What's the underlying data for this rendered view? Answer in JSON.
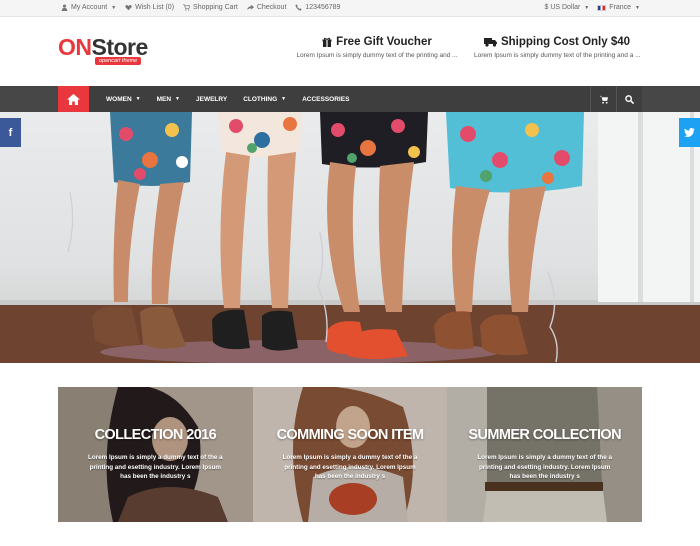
{
  "topbar": {
    "account": "My Account",
    "wishlist": "Wish List (0)",
    "cart": "Shopping Cart",
    "checkout": "Checkout",
    "phone": "123456789",
    "currency": "$ US Dollar",
    "language": "France"
  },
  "brand": {
    "on": "ON",
    "store": "Store",
    "tagline": "opencart theme"
  },
  "promos": [
    {
      "title": "Free Gift Voucher",
      "subtitle": "Lorem Ipsum is simply dummy text of the printing and ...",
      "icon": "gift-icon"
    },
    {
      "title": "Shipping Cost Only $40",
      "subtitle": "Lorem Ipsum is simply dummy text of the printing and a ...",
      "icon": "truck-icon"
    }
  ],
  "nav": {
    "items": [
      "WOMEN",
      "MEN",
      "JEWELRY",
      "CLOTHING",
      "ACCESSORIES"
    ],
    "has_dropdown": [
      true,
      true,
      false,
      true,
      false
    ]
  },
  "collections": [
    {
      "title": "COLLECTION 2016",
      "text": "Lorem Ipsum is simply a dummy text of the a printing and esetting industry. Lorem Ipsum has been the industry s"
    },
    {
      "title": "COMMING SOON ITEM",
      "text": "Lorem Ipsum is simply a dummy text of the a printing and esetting industry. Lorem Ipsum has been the industry s"
    },
    {
      "title": "SUMMER COLLECTION",
      "text": "Lorem Ipsum is simply a dummy text of the a printing and esetting industry. Lorem Ipsum has been the industry s"
    }
  ],
  "colors": {
    "accent": "#e8383d",
    "nav_bg": "#3e3e3e",
    "facebook": "#3b5998",
    "twitter": "#1da1f2"
  }
}
